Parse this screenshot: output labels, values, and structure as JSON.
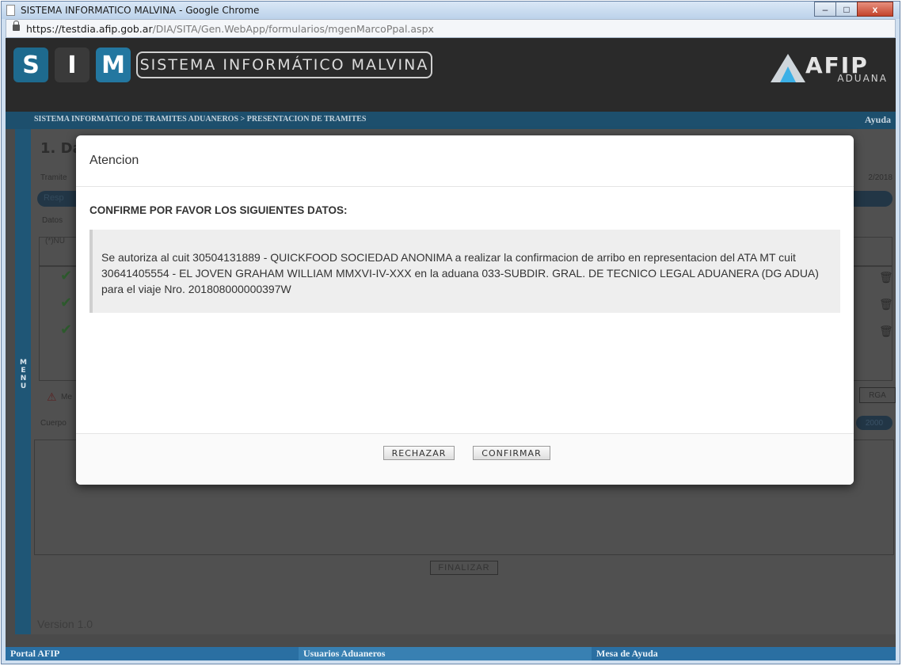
{
  "window": {
    "title": "SISTEMA INFORMATICO MALVINA - Google Chrome",
    "controls": {
      "minimize": "–",
      "maximize": "□",
      "close": "x"
    }
  },
  "address_bar": {
    "host": "https://testdia.afip.gob.ar",
    "path": "/DIA/SITA/Gen.WebApp/formularios/mgenMarcoPpal.aspx"
  },
  "header": {
    "logo_letters": [
      "S",
      "I",
      "M"
    ],
    "system_name": "SISTEMA INFORMÁTICO MALVINA",
    "brand_letters": "AFIP",
    "brand_sub": "ADUANA"
  },
  "nav": {
    "breadcrumb": "SISTEMA INFORMATICO DE TRAMITES ADUANEROS > PRESENTACION DE TRAMITES",
    "help": "Ayuda"
  },
  "side_menu": {
    "label": "MENU"
  },
  "background": {
    "section_title": "1. Da",
    "tramite_label": "Tramite",
    "date_fragment": "2/2018",
    "responsable_fragment": "Resp",
    "datos_fragment": "Datos",
    "nu_fragment": "(*)NU",
    "check_icon": "✔",
    "trash_icon": "🗑",
    "warning_icon": "⚠",
    "me_fragment": "Me",
    "carga_fragment": "RGA",
    "cuerpo_fragment": "Cuerpo",
    "count": "2000",
    "finalizar": "FINALIZAR",
    "version": "Version 1.0"
  },
  "footer": {
    "portal": "Portal AFIP",
    "usuarios": "Usuarios Aduaneros",
    "mesa": "Mesa de Ayuda"
  },
  "modal": {
    "title": "Atencion",
    "heading": "CONFIRME POR FAVOR LOS SIGUIENTES DATOS:",
    "message": "Se autoriza al cuit 30504131889 - QUICKFOOD SOCIEDAD ANONIMA a realizar la confirmacion de arribo en representacion del ATA MT cuit 30641405554 - EL JOVEN GRAHAM WILLIAM MMXVI-IV-XXX en la aduana 033-SUBDIR. GRAL. DE TECNICO LEGAL ADUANERA (DG ADUA) para el viaje Nro. 201808000000397W",
    "reject_label": "RECHAZAR",
    "confirm_label": "CONFIRMAR"
  },
  "colors": {
    "nav_blue": "#1d4f6d",
    "footer_blue": "#2a6fa2",
    "overlay": "#4a4a4a"
  }
}
